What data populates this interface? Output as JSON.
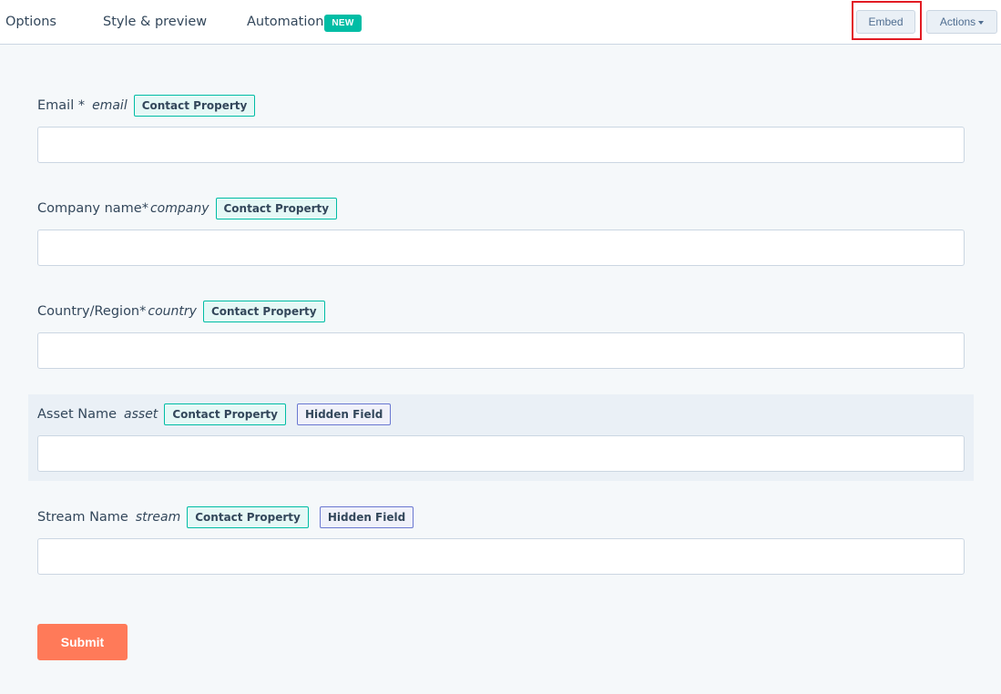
{
  "tabs": {
    "options": "Options",
    "style_preview": "Style & preview",
    "automation": "Automation",
    "new_badge": "NEW"
  },
  "toolbar": {
    "embed_label": "Embed",
    "actions_label": "Actions"
  },
  "form": {
    "fields": [
      {
        "label": "Email *",
        "property": "email",
        "tags": [
          "Contact Property"
        ]
      },
      {
        "label": "Company name*",
        "property": "company",
        "tags": [
          "Contact Property"
        ]
      },
      {
        "label": "Country/Region*",
        "property": "country",
        "tags": [
          "Contact Property"
        ]
      },
      {
        "label": "Asset Name",
        "property": "asset",
        "tags": [
          "Contact Property",
          "Hidden Field"
        ]
      },
      {
        "label": "Stream Name",
        "property": "stream",
        "tags": [
          "Contact Property",
          "Hidden Field"
        ]
      }
    ],
    "submit_label": "Submit"
  },
  "colors": {
    "accent_submit": "#ff7a59",
    "badge_new": "#00bda5",
    "tag_contact_border": "#00bda5",
    "tag_hidden_border": "#6a78d1",
    "highlight": "#e21b23"
  },
  "icons": {
    "actions_caret": "caret-down-icon"
  }
}
